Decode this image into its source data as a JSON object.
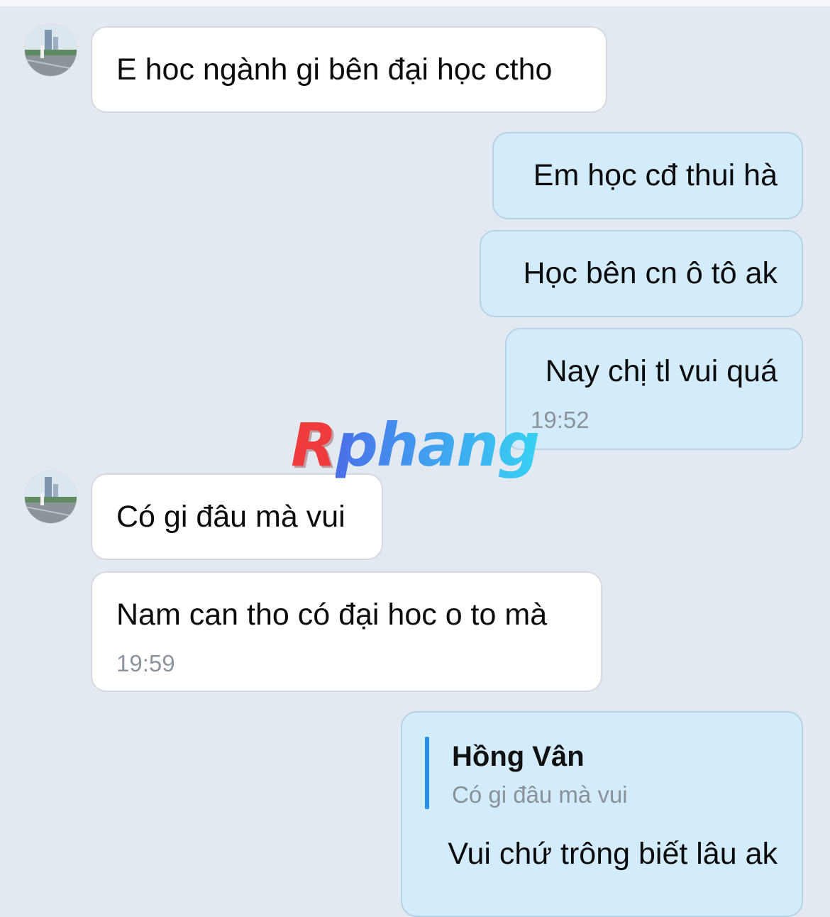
{
  "messages": [
    {
      "id": "m1",
      "direction": "incoming",
      "text": "E hoc ngành gi bên đại học ctho"
    },
    {
      "id": "m2",
      "direction": "outgoing",
      "text": "Em học cđ thui hà"
    },
    {
      "id": "m3",
      "direction": "outgoing",
      "text": "Học bên cn ô tô ak"
    },
    {
      "id": "m4",
      "direction": "outgoing",
      "text": "Nay chị tl vui quá",
      "time": "19:52"
    },
    {
      "id": "m5",
      "direction": "incoming",
      "text": "Có gi đâu mà vui"
    },
    {
      "id": "m6",
      "direction": "incoming",
      "text": "Nam can tho có đại hoc o to mà",
      "time": "19:59"
    },
    {
      "id": "m7",
      "direction": "outgoing",
      "reply": {
        "author": "Hồng Vân",
        "snippet": "Có gi đâu mà vui"
      },
      "text": "Vui chứ trông biết lâu ak"
    }
  ],
  "watermark": {
    "first_letter": "R",
    "rest": "phang"
  },
  "colors": {
    "background": "#e3e9f1",
    "incoming_bubble": "#ffffff",
    "outgoing_bubble": "#d2ecfc",
    "reply_accent": "#2a8fe6",
    "timestamp": "#8d949c"
  },
  "icons": {
    "avatar": "contact-avatar-photo"
  }
}
